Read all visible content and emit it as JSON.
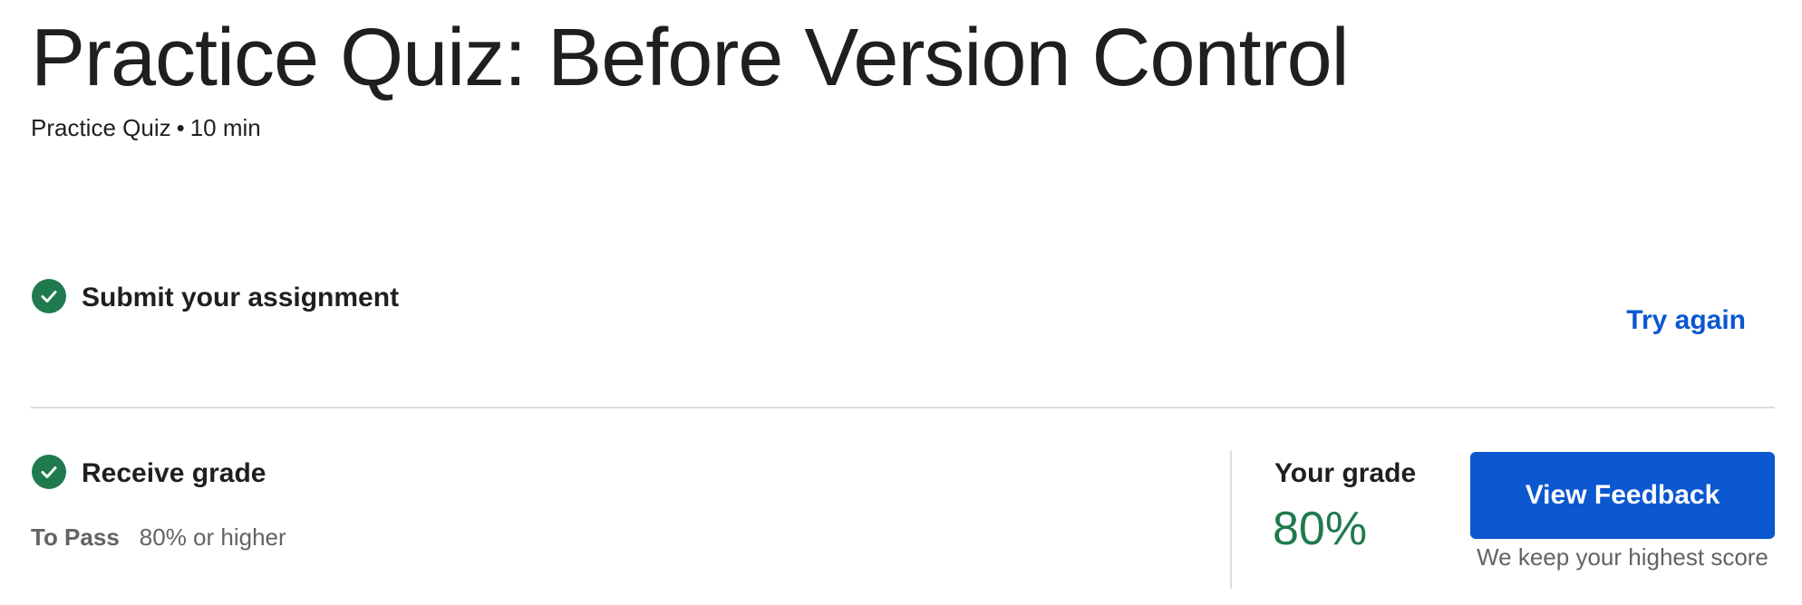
{
  "header": {
    "title": "Practice Quiz: Before Version Control",
    "item_type": "Practice Quiz",
    "separator": "•",
    "duration": "10 min"
  },
  "steps": {
    "submit": {
      "title": "Submit your assignment",
      "status_icon": "check-circle-icon",
      "action_label": "Try again"
    },
    "grade": {
      "title": "Receive grade",
      "status_icon": "check-circle-icon",
      "to_pass_label": "To Pass",
      "to_pass_value": "80% or higher"
    }
  },
  "result": {
    "your_grade_label": "Your grade",
    "your_grade_value": "80%",
    "feedback_button_label": "View Feedback",
    "note": "We keep your highest score"
  },
  "colors": {
    "accent_blue": "#0b57d0",
    "success_green": "#1f7a4d",
    "divider": "#dcdcdc"
  }
}
